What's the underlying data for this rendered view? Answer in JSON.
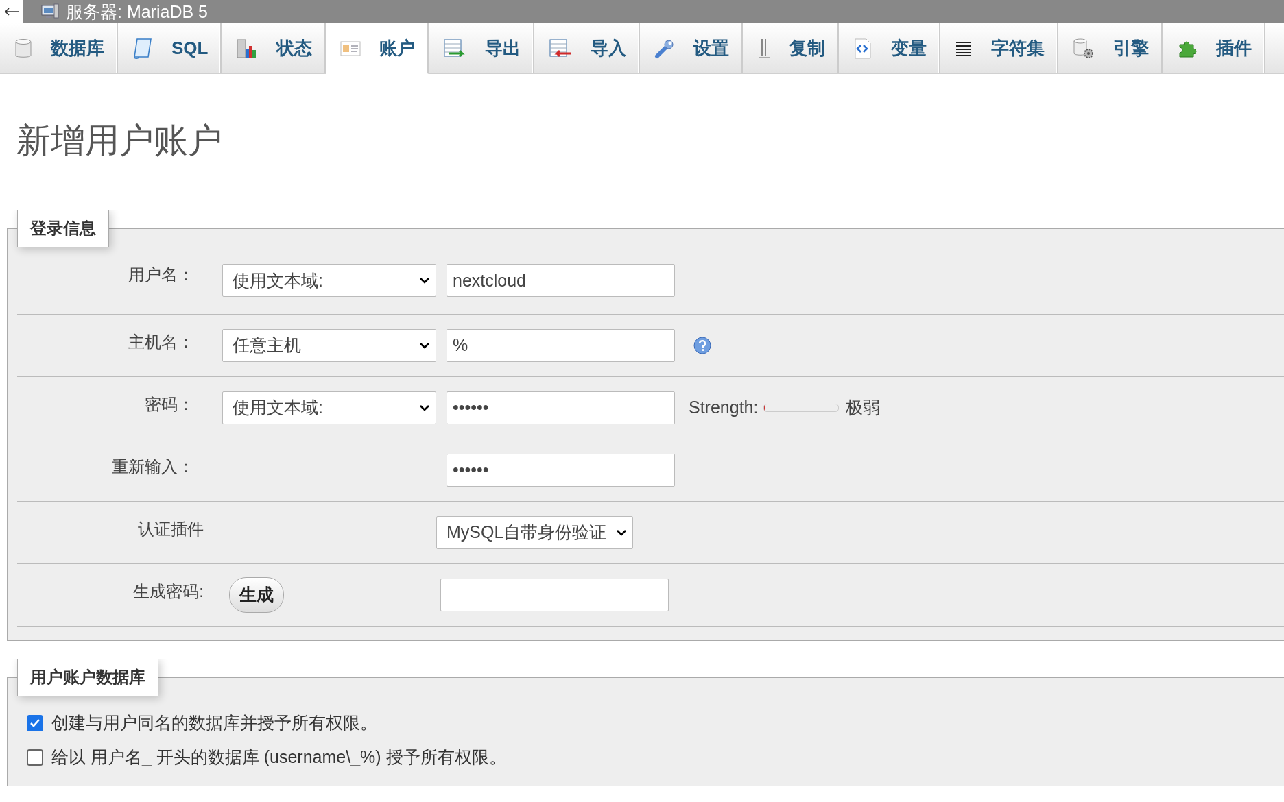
{
  "window": {
    "title": "服务器: MariaDB 5"
  },
  "tabs": [
    {
      "label": "数据库",
      "selected": false
    },
    {
      "label": "SQL",
      "selected": false
    },
    {
      "label": "状态",
      "selected": false
    },
    {
      "label": "账户",
      "selected": true
    },
    {
      "label": "导出",
      "selected": false
    },
    {
      "label": "导入",
      "selected": false
    },
    {
      "label": "设置",
      "selected": false
    },
    {
      "label": "复制",
      "selected": false
    },
    {
      "label": "变量",
      "selected": false
    },
    {
      "label": "字符集",
      "selected": false
    },
    {
      "label": "引擎",
      "selected": false
    },
    {
      "label": "插件",
      "selected": false
    }
  ],
  "heading": "新增用户账户",
  "login_section": {
    "legend": "登录信息",
    "rows": [
      {
        "kind": "select-input",
        "label": "用户名：",
        "select": "使用文本域:",
        "value": "nextcloud",
        "help": false
      },
      {
        "kind": "select-input",
        "label": "主机名：",
        "select": "任意主机",
        "value": "%",
        "help": true
      },
      {
        "kind": "password",
        "label": "密码：",
        "select": "使用文本域:",
        "value": "••••••",
        "strength_label": "Strength:",
        "level": 0,
        "strength_text": "极弱"
      },
      {
        "kind": "input",
        "label": "重新输入：",
        "value": "••••••"
      },
      {
        "kind": "select",
        "label": "认证插件",
        "select": "MySQL自带身份验证"
      },
      {
        "kind": "generate",
        "label": "生成密码:",
        "button": "生成"
      }
    ]
  },
  "database_section": {
    "legend": "用户账户数据库",
    "options": [
      {
        "label": "创建与用户同名的数据库并授予所有权限。",
        "checked": true
      },
      {
        "label": "给以 用户名_ 开头的数据库 (username\\_%) 授予所有权限。",
        "checked": false
      }
    ]
  }
}
